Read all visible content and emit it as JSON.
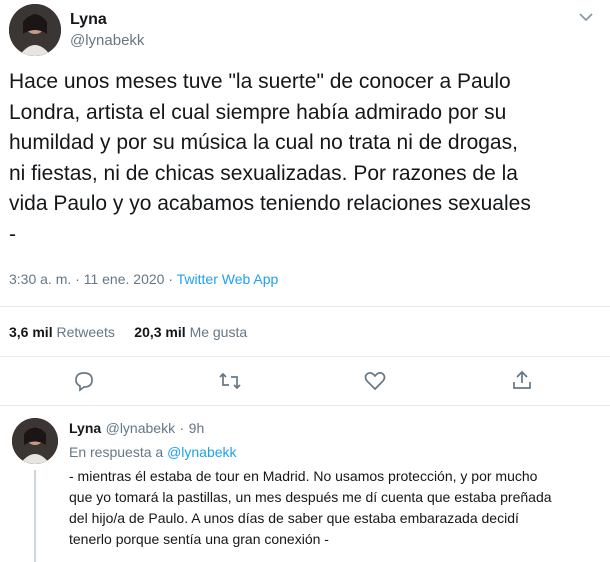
{
  "main_tweet": {
    "author_name": "Lyna",
    "author_handle": "@lynabekk",
    "menu_icon": "chevron-down-icon",
    "text": "Hace unos meses tuve \"la suerte\" de conocer a Paulo\nLondra, artista el cual siempre había admirado por su\nhumildad y por su música la cual no trata ni de drogas,\nni fiestas, ni de chicas sexualizadas. Por razones de la\nvida Paulo y yo acabamos teniendo relaciones sexuales\n-",
    "time": "3:30 a. m.",
    "separator": "·",
    "date": "11 ene. 2020",
    "source": "Twitter Web App",
    "retweets_count": "3,6 mil",
    "retweets_label": "Retweets",
    "likes_count": "20,3 mil",
    "likes_label": "Me gusta",
    "actions": [
      "reply-icon",
      "retweet-icon",
      "like-icon",
      "share-icon"
    ]
  },
  "reply_tweet": {
    "author_name": "Lyna",
    "author_handle": "@lynabekk",
    "separator": "·",
    "time_ago": "9h",
    "replying_prefix": "En respuesta a",
    "replying_to": "@lynabekk",
    "text": "- mientras él estaba de tour en Madrid. No usamos protección, y por mucho\nque yo tomará la pastillas, un mes después me dí cuenta que estaba preñada\ndel hijo/a de Paulo. A unos días de saber que estaba embarazada decidí\ntenerlo porque sentía una gran conexión -"
  },
  "colors": {
    "accent": "#1da1f2",
    "secondary_text": "#657786",
    "divider": "#e6ecf0"
  }
}
